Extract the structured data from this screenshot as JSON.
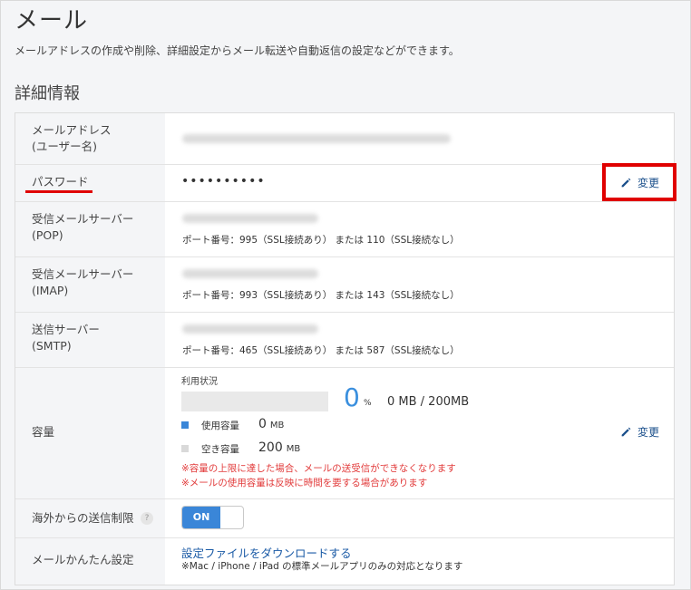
{
  "page": {
    "title": "メール",
    "description": "メールアドレスの作成や削除、詳細設定からメール転送や自動返信の設定などができます。",
    "section_title": "詳細情報"
  },
  "rows": {
    "email": {
      "label_line1": "メールアドレス",
      "label_line2": "(ユーザー名)"
    },
    "password": {
      "label": "パスワード",
      "value": "••••••••••",
      "edit_label": "変更"
    },
    "pop": {
      "label_line1": "受信メールサーバー",
      "label_line2": "(POP)",
      "ports": "ポート番号：995（SSL接続あり） または 110（SSL接続なし）"
    },
    "imap": {
      "label_line1": "受信メールサーバー",
      "label_line2": "(IMAP)",
      "ports": "ポート番号：993（SSL接続あり） または 143（SSL接続なし）"
    },
    "smtp": {
      "label_line1": "送信サーバー",
      "label_line2": "(SMTP)",
      "ports": "ポート番号：465（SSL接続あり） または 587（SSL接続なし）"
    },
    "capacity": {
      "label": "容量",
      "usage_title": "利用状況",
      "usage_percent": "0",
      "percent_unit": "%",
      "usage_text": "0 MB / 200MB",
      "used_label": "使用容量",
      "used_value": "0",
      "used_unit": "MB",
      "free_label": "空き容量",
      "free_value": "200",
      "free_unit": "MB",
      "warning1": "※容量の上限に達した場合、メールの送受信ができなくなります",
      "warning2": "※メールの使用容量は反映に時間を要する場合があります",
      "edit_label": "変更",
      "used_color": "#3a86d8",
      "free_color": "#d9d9d9"
    },
    "overseas": {
      "label": "海外からの送信制限",
      "help": "?",
      "toggle_label": "ON",
      "toggle_state": "on"
    },
    "easy_setup": {
      "label": "メールかんたん設定",
      "link": "設定ファイルをダウンロードする",
      "note": "※Mac / iPhone / iPad の標準メールアプリのみの対応となります"
    }
  },
  "colors": {
    "accent": "#3a86d8",
    "highlight": "#e00000",
    "warning": "#e23c3c",
    "link": "#1a5aa6"
  }
}
